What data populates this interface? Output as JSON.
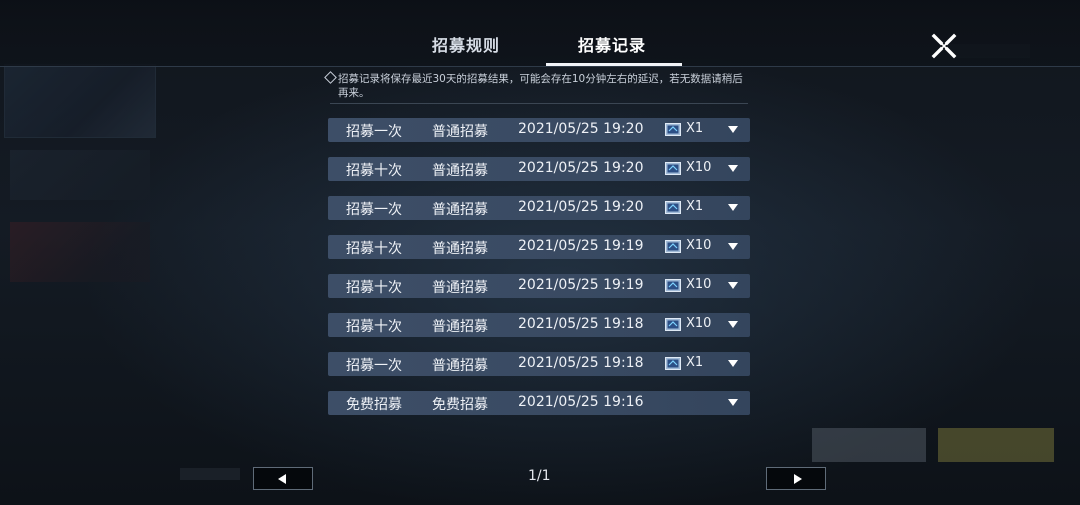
{
  "tabs": [
    {
      "label": "招募规则",
      "active": false
    },
    {
      "label": "招募记录",
      "active": true
    }
  ],
  "close_icon": "close-icon",
  "notice": {
    "icon": "diamond-bullet-icon",
    "text": "招募记录将保存最近30天的招募结果，可能会存在10分钟左右的延迟，若无数据请稍后再来。"
  },
  "records": [
    {
      "type": "招募一次",
      "pool": "普通招募",
      "time": "2021/05/25 19:20",
      "qty": "X1",
      "has_ticket": true
    },
    {
      "type": "招募十次",
      "pool": "普通招募",
      "time": "2021/05/25 19:20",
      "qty": "X10",
      "has_ticket": true
    },
    {
      "type": "招募一次",
      "pool": "普通招募",
      "time": "2021/05/25 19:20",
      "qty": "X1",
      "has_ticket": true
    },
    {
      "type": "招募十次",
      "pool": "普通招募",
      "time": "2021/05/25 19:19",
      "qty": "X10",
      "has_ticket": true
    },
    {
      "type": "招募十次",
      "pool": "普通招募",
      "time": "2021/05/25 19:19",
      "qty": "X10",
      "has_ticket": true
    },
    {
      "type": "招募十次",
      "pool": "普通招募",
      "time": "2021/05/25 19:18",
      "qty": "X10",
      "has_ticket": true
    },
    {
      "type": "招募一次",
      "pool": "普通招募",
      "time": "2021/05/25 19:18",
      "qty": "X1",
      "has_ticket": true
    },
    {
      "type": "免费招募",
      "pool": "免费招募",
      "time": "2021/05/25 19:16",
      "qty": "",
      "has_ticket": false
    }
  ],
  "pagination": {
    "indicator": "1/1"
  },
  "colors": {
    "row_bg": "#3d4e67",
    "accent": "#ffffff",
    "background": "#141b24"
  }
}
